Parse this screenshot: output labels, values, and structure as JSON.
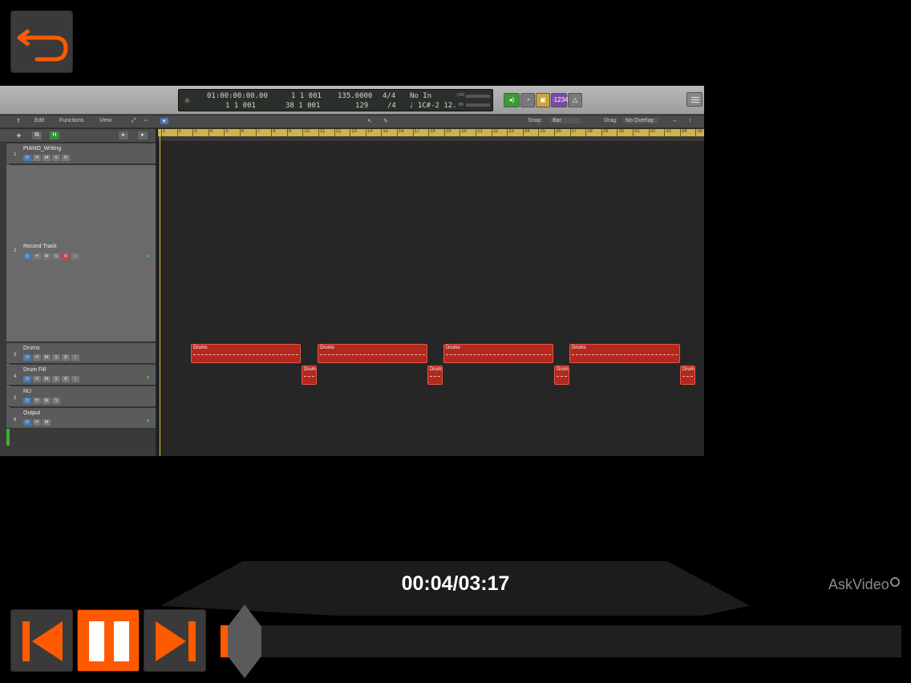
{
  "player": {
    "timecode": "00:04/03:17",
    "progress_fraction": 0.02,
    "brand": "AskVideo",
    "accent_color": "#ff5a00",
    "icons": {
      "back": "undo-arrow-icon",
      "previous": "skip-previous-icon",
      "pause": "pause-icon",
      "next": "skip-next-icon"
    }
  },
  "lcd": {
    "smpte": "01:00:00:00.00",
    "bars_beats": "1  1  001",
    "tempo": "135.0000",
    "signature": "4/4",
    "in_label": "No In",
    "row2_left": "1  1  001",
    "row2_pos": "38  1  001",
    "row2_div": "129",
    "row2_sig": "/4",
    "row2_note": "♩ 1C#-2  12.",
    "cpu_label": "CPU",
    "hd_label": "HD"
  },
  "toolbar": {
    "edit": "Edit",
    "functions": "Functions",
    "view": "View",
    "snap_label": "Snap:",
    "snap_value": "Bar",
    "drag_label": "Drag:",
    "drag_value": "No Overlap"
  },
  "tracks": [
    {
      "num": "1",
      "name": "PIANO_Writing",
      "buttons": [
        "⏻",
        "H",
        "M",
        "S",
        "R"
      ]
    },
    {
      "num": "2",
      "name": "Record Track",
      "buttons": [
        "⏻",
        "H",
        "M",
        "S",
        "R",
        "I"
      ]
    },
    {
      "num": "3",
      "name": "Drums",
      "buttons": [
        "⏻",
        "H",
        "M",
        "S",
        "R",
        "I"
      ]
    },
    {
      "num": "4",
      "name": "Drum Fill",
      "buttons": [
        "⏻",
        "H",
        "M",
        "S",
        "R",
        "I"
      ]
    },
    {
      "num": "5",
      "name": "NU",
      "buttons": [
        "⏻",
        "H",
        "M",
        "S"
      ]
    },
    {
      "num": "6",
      "name": "Output",
      "buttons": [
        "⏻",
        "H",
        "M"
      ]
    }
  ],
  "ruler": [
    "1",
    "2",
    "3",
    "4",
    "5",
    "6",
    "7",
    "8",
    "9",
    "10",
    "11",
    "12",
    "13",
    "14",
    "15",
    "16",
    "17",
    "18",
    "19",
    "20",
    "21",
    "22",
    "23",
    "24",
    "25",
    "26",
    "27",
    "28",
    "29",
    "30",
    "31",
    "32",
    "33",
    "34",
    "35"
  ],
  "regions": {
    "drums_label": "Drums",
    "fill_label": "Drum"
  }
}
